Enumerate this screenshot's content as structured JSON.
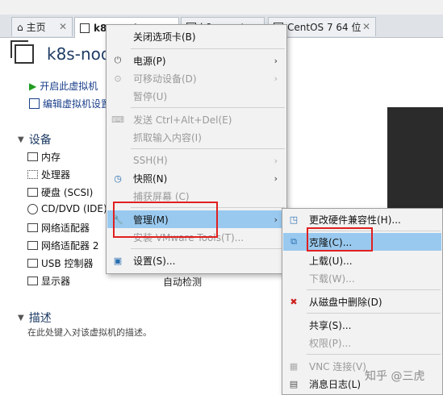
{
  "tabs": [
    {
      "label": "主页"
    },
    {
      "label": "k8s-node3"
    },
    {
      "label": "k8s-master"
    },
    {
      "label": "CentOS 7 64 位"
    }
  ],
  "vm": {
    "name": "k8s-node3"
  },
  "actions": {
    "start": "开启此虚拟机",
    "edit": "编辑虚拟机设置"
  },
  "devices_section": {
    "title": "设备"
  },
  "devices": [
    {
      "name": "内存",
      "value": ""
    },
    {
      "name": "处理器",
      "value": ""
    },
    {
      "name": "硬盘 (SCSI)",
      "value": ""
    },
    {
      "name": "CD/DVD (IDE)",
      "value": ""
    },
    {
      "name": "网络适配器",
      "value": ""
    },
    {
      "name": "网络适配器 2",
      "value": ""
    },
    {
      "name": "USB 控制器",
      "value": ""
    },
    {
      "name": "显示器",
      "value": "自动检测"
    }
  ],
  "description": {
    "title": "描述",
    "placeholder": "在此处键入对该虚拟机的描述。"
  },
  "context_menu": {
    "close_tab": "关闭选项卡(B)",
    "power": "电源(P)",
    "removable": "可移动设备(D)",
    "pause": "暂停(U)",
    "send_cad": "发送 Ctrl+Alt+Del(E)",
    "grab_input": "抓取输入内容(I)",
    "ssh": "SSH(H)",
    "snapshot": "快照(N)",
    "capture_screen": "捕获屏幕 (C)",
    "manage": "管理(M)",
    "install_tools": "安装 VMware Tools(T)...",
    "settings": "设置(S)..."
  },
  "submenu": {
    "change_hw": "更改硬件兼容性(H)...",
    "clone": "克隆(C)...",
    "upload": "上载(U)...",
    "download": "下载(W)...",
    "delete_disk": "从磁盘中删除(D)",
    "share": "共享(S)...",
    "permissions": "权限(P)...",
    "vnc": "VNC 连接(V)",
    "message_log": "消息日志(L)"
  },
  "watermark": "知乎 @三虎",
  "colors": {
    "highlight": "#99c9ef",
    "annotation_red": "#e02020",
    "title_blue": "#1f3c66"
  }
}
